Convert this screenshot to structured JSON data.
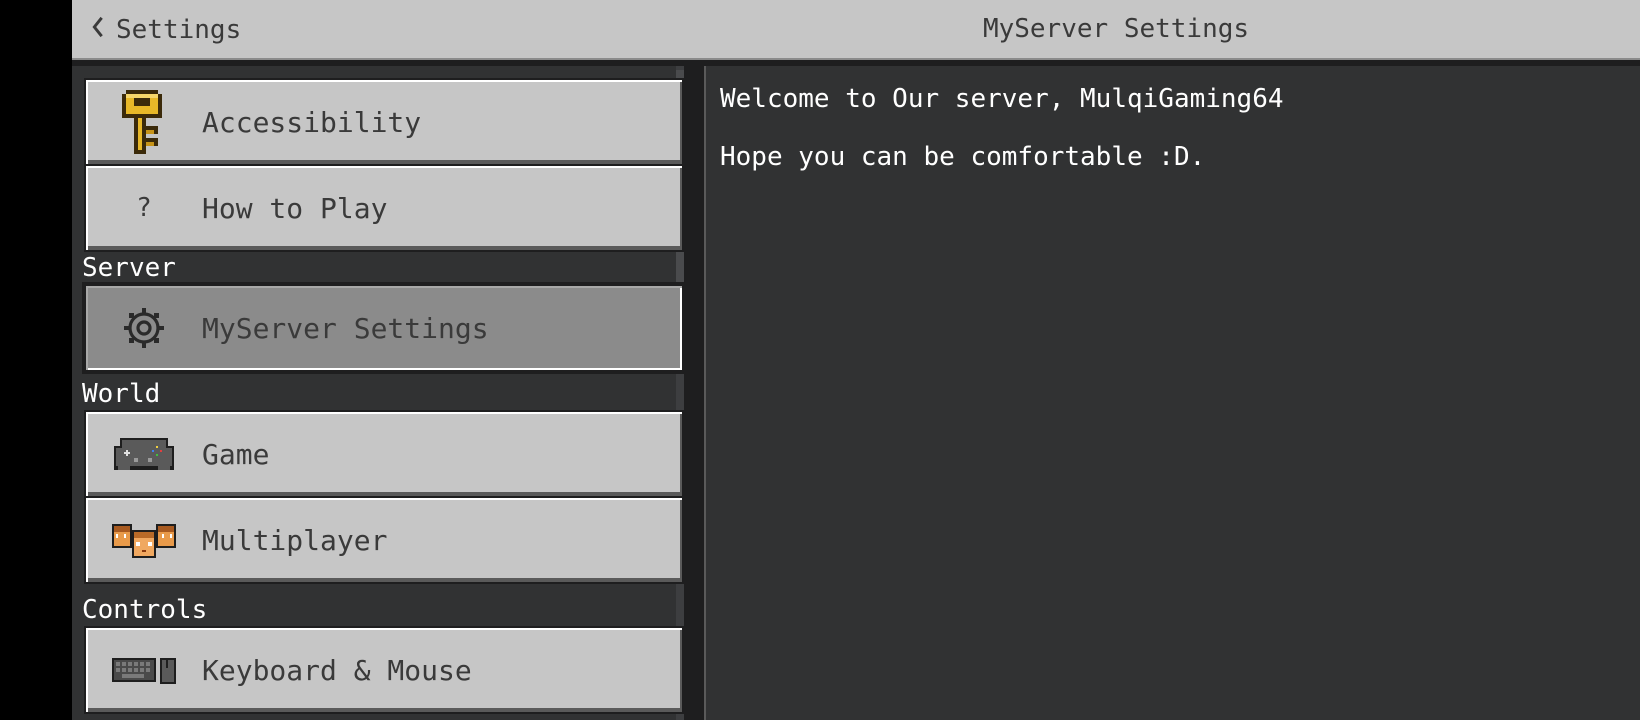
{
  "header": {
    "back_label": "Settings",
    "title": "MyServer Settings"
  },
  "sidebar": {
    "items_top": [
      {
        "label": "Accessibility",
        "icon": "key-icon"
      },
      {
        "label": "How to Play",
        "icon": "question-icon",
        "glyph": "?"
      }
    ],
    "sections": [
      {
        "label": "Server",
        "items": [
          {
            "label": "MyServer Settings",
            "icon": "gear-icon",
            "selected": true
          }
        ]
      },
      {
        "label": "World",
        "items": [
          {
            "label": "Game",
            "icon": "controller-icon"
          },
          {
            "label": "Multiplayer",
            "icon": "players-icon"
          }
        ]
      },
      {
        "label": "Controls",
        "items": [
          {
            "label": "Keyboard & Mouse",
            "icon": "keyboard-mouse-icon"
          }
        ]
      }
    ]
  },
  "main": {
    "lines": [
      "Welcome to Our server, MulqiGaming64",
      "Hope you can be comfortable :D."
    ]
  },
  "colors": {
    "header_bg": "#c6c6c6",
    "panel_bg": "#313233",
    "button_bg": "#c6c6c6",
    "button_selected_bg": "#8b8b8b",
    "text_light": "#ffffff",
    "text_dark": "#3a3a3a"
  }
}
